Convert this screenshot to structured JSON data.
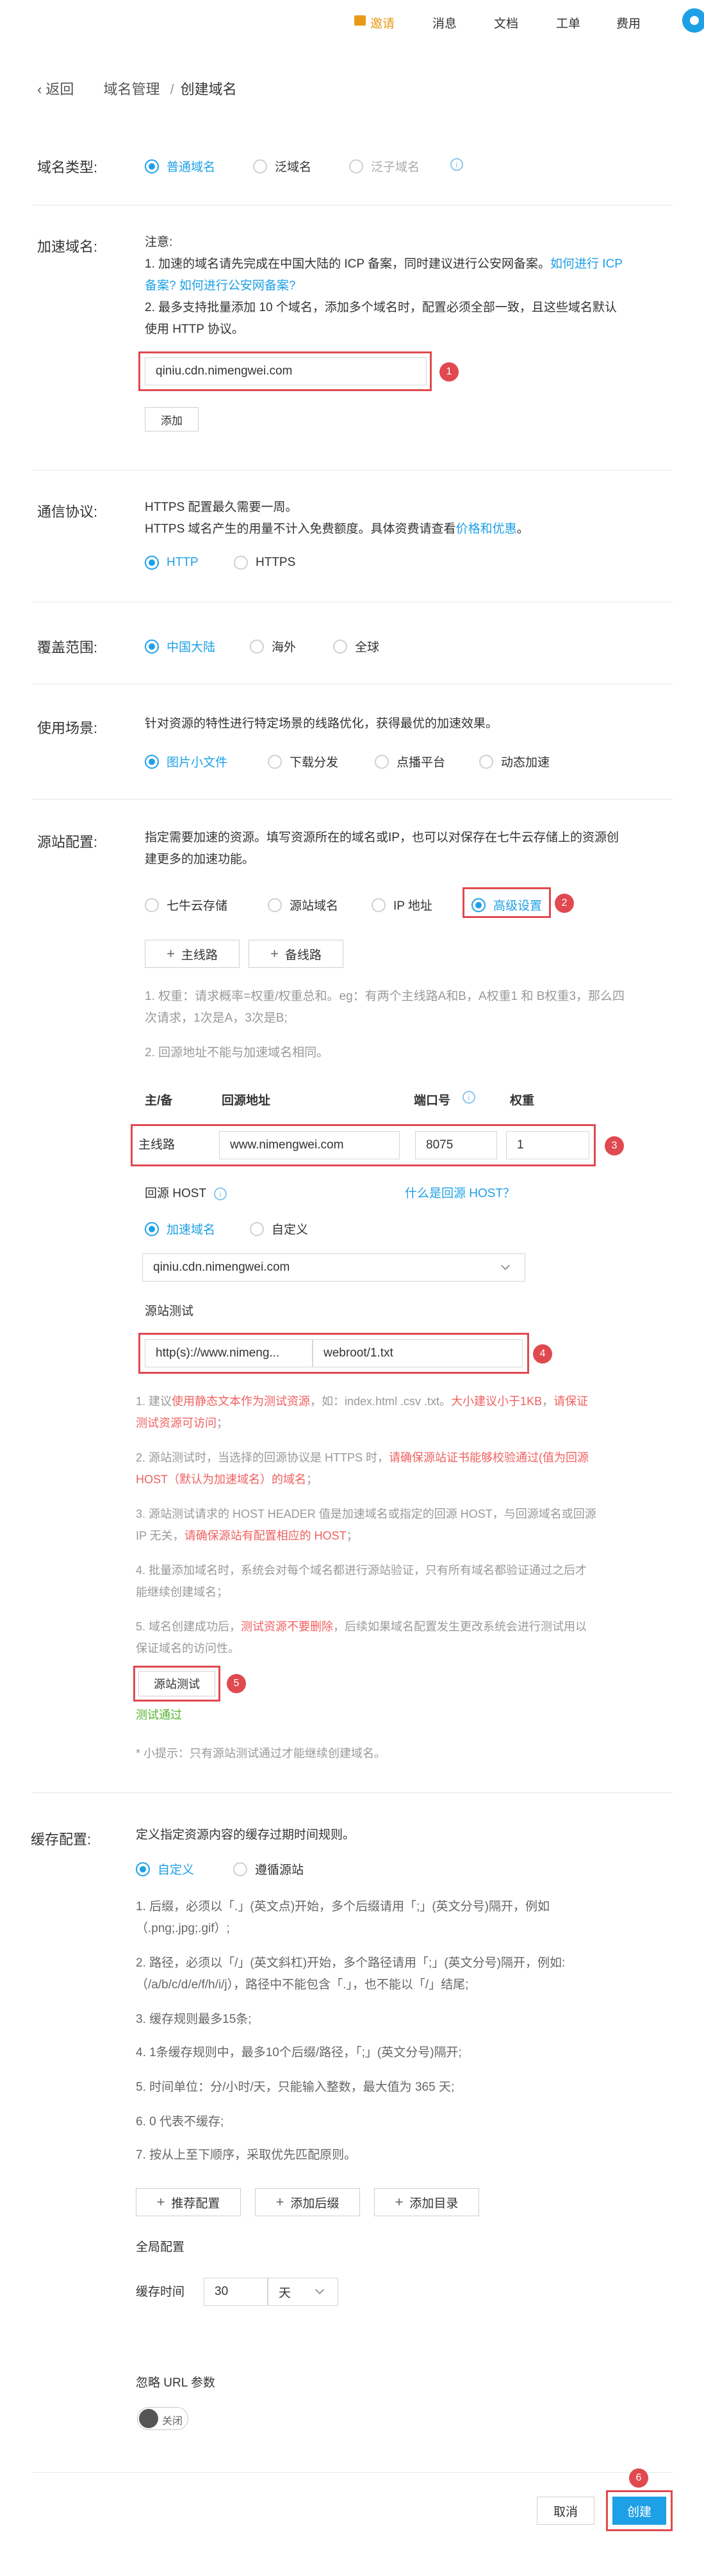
{
  "topbar": {
    "invite": "邀请",
    "messages": "消息",
    "docs": "文档",
    "tickets": "工单",
    "billing": "费用"
  },
  "breadcrumb": {
    "back": "返回",
    "parent": "域名管理",
    "separator": "/",
    "current": "创建域名"
  },
  "domain_type": {
    "label": "域名类型:",
    "options": [
      "普通域名",
      "泛域名",
      "泛子域名"
    ]
  },
  "accel_domain": {
    "label": "加速域名:",
    "note_title": "注意:",
    "note1": "1. 加速的域名请先完成在中国大陆的 ICP 备案，同时建议进行公安网备案。",
    "note1_link_a": "如何进行 ICP",
    "note1_link_b": "备案? 如何进行公安网备案?",
    "note2a": "2. 最多支持批量添加 10 个域名，添加多个域名时，配置必须全部一致，且这些域名默认",
    "note2b": "使用 HTTP 协议。",
    "domain_value": "qiniu.cdn.nimengwei.com",
    "add_button": "添加"
  },
  "protocol": {
    "label": "通信协议:",
    "desc1": "HTTPS 配置最久需要一周。",
    "desc2": "HTTPS 域名产生的用量不计入免费额度。具体资费请查看",
    "desc2_link": "价格和优惠",
    "desc2_end": "。",
    "options": [
      "HTTP",
      "HTTPS"
    ]
  },
  "coverage": {
    "label": "覆盖范围:",
    "options": [
      "中国大陆",
      "海外",
      "全球"
    ]
  },
  "scenario": {
    "label": "使用场景:",
    "desc": "针对资源的特性进行特定场景的线路优化，获得最优的加速效果。",
    "options": [
      "图片小文件",
      "下载分发",
      "点播平台",
      "动态加速"
    ]
  },
  "origin": {
    "label": "源站配置:",
    "desc1": "指定需要加速的资源。填写资源所在的域名或IP，也可以对保存在七牛云存储上的资源创",
    "desc2": "建更多的加速功能。",
    "options": [
      "七牛云存储",
      "源站域名",
      "IP 地址",
      "高级设置"
    ],
    "main_line_button": "主线路",
    "backup_line_button": "备线路",
    "weight_note1": "1. 权重：请求概率=权重/权重总和。eg：有两个主线路A和B，A权重1 和 B权重3，那么四",
    "weight_note2": "次请求，1次是A，3次是B;",
    "note_2": "2. 回源地址不能与加速域名相同。",
    "table_headers": [
      "主/备",
      "回源地址",
      "端口号",
      "权重"
    ],
    "row": {
      "type": "主线路",
      "address": "www.nimengwei.com",
      "port": "8075",
      "weight": "1"
    },
    "host_label": "回源 HOST",
    "host_help_link": "什么是回源 HOST？",
    "host_options": [
      "加速域名",
      "自定义"
    ],
    "host_value": "qiniu.cdn.nimengwei.com",
    "test_label": "源站测试",
    "test_protocol": "http(s)://www.nimeng...",
    "test_path": "webroot/1.txt",
    "tips": {
      "t1a": "1. 建议",
      "t1b": "使用静态文本作为测试资源",
      "t1c": "，如：index.html .csv .txt。",
      "t1d": "大小建议小于1KB",
      "t1e": "，",
      "t1f": "请保证",
      "t1g": "测试资源可访问",
      "t1h": "；",
      "t2a": "2. 源站测试时，当选择的回源协议是 HTTPS 时，",
      "t2b": "请确保源站证书能够校验通过(值为回源",
      "t2c": "HOST（默认为加速域名）的域名",
      "t2d": "；",
      "t3a": "3. 源站测试请求的 HOST HEADER 值是加速域名或指定的回源 HOST，与回源域名或回源",
      "t3b": "IP 无关，",
      "t3c": "请确保源站有配置相应的 HOST",
      "t3d": "；",
      "t4a": "4. 批量添加域名时，系统会对每个域名都进行源站验证，只有所有域名都验证通过之后才",
      "t4b": "能继续创建域名；",
      "t5a": "5. 域名创建成功后，",
      "t5b": "测试资源不要删除",
      "t5c": "，后续如果域名配置发生更改系统会进行测试用以",
      "t5d": "保证域名的访问性。"
    },
    "test_button": "源站测试",
    "test_result": "测试通过",
    "hint": "* 小提示：只有源站测试通过才能继续创建域名。"
  },
  "cache": {
    "label": "缓存配置:",
    "desc": "定义指定资源内容的缓存过期时间规则。",
    "options": [
      "自定义",
      "遵循源站"
    ],
    "rules": [
      "1. 后缀，必须以「.」(英文点)开始，多个后缀请用「;」(英文分号)隔开，例如",
      "（.png;.jpg;.gif）;",
      "2. 路径，必须以「/」(英文斜杠)开始，多个路径请用「;」(英文分号)隔开，例如:",
      "（/a/b/c/d/e/f/h/i/j），路径中不能包含「.」，也不能以「/」结尾;",
      "3. 缓存规则最多15条;",
      "4. 1条缓存规则中，最多10个后缀/路径，「;」(英文分号)隔开;",
      "5. 时间单位：分/小时/天，只能输入整数，最大值为 365 天;",
      "6. 0 代表不缓存;",
      "7. 按从上至下顺序，采取优先匹配原则。"
    ],
    "buttons": [
      "推荐配置",
      "添加后缀",
      "添加目录"
    ],
    "global_label": "全局配置",
    "cache_time_label": "缓存时间",
    "cache_time_value": "30",
    "cache_time_unit": "天",
    "ignore_url_label": "忽略 URL 参数",
    "toggle_label": "关闭"
  },
  "footer": {
    "cancel": "取消",
    "create": "创建"
  },
  "callouts": [
    "1",
    "2",
    "3",
    "4",
    "5",
    "6"
  ]
}
